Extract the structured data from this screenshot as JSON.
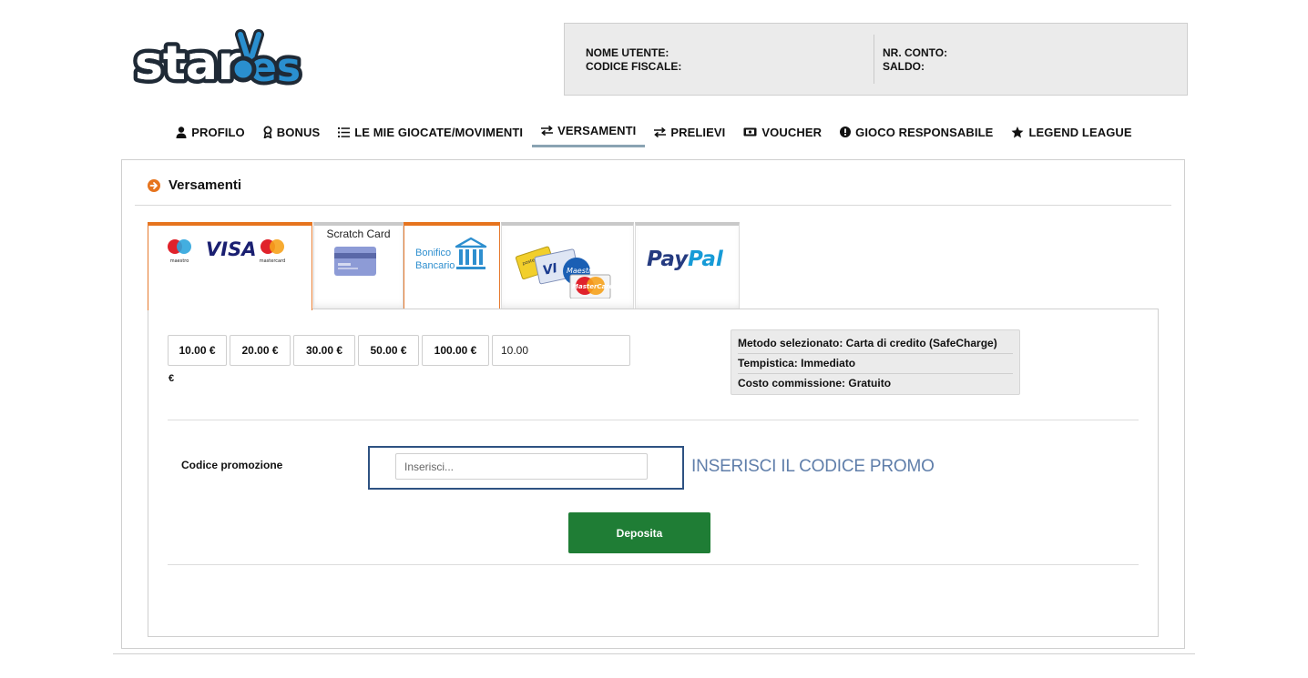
{
  "header": {
    "logo_text": "starVes",
    "account": {
      "username_label": "NOME UTENTE:",
      "fiscal_code_label": "CODICE FISCALE:",
      "account_number_label": "NR. CONTO:",
      "balance_label": "SALDO:"
    }
  },
  "nav": {
    "items": [
      {
        "label": "PROFILO",
        "icon": "user-icon"
      },
      {
        "label": "BONUS",
        "icon": "award-icon"
      },
      {
        "label": "LE MIE GIOCATE/MOVIMENTI",
        "icon": "list-icon"
      },
      {
        "label": "VERSAMENTI",
        "icon": "transfer-icon",
        "active": true
      },
      {
        "label": "PRELIEVI",
        "icon": "transfer-icon"
      },
      {
        "label": "VOUCHER",
        "icon": "ticket-icon"
      },
      {
        "label": "GIOCO RESPONSABILE",
        "icon": "info-circle-icon"
      },
      {
        "label": "LEGEND LEAGUE",
        "icon": "star-icon"
      }
    ]
  },
  "panel": {
    "title": "Versamenti",
    "tabs": [
      {
        "id": "cards",
        "logos": [
          "maestro",
          "VISA",
          "mastercard"
        ],
        "active": true
      },
      {
        "id": "scratch",
        "label": "Scratch Card"
      },
      {
        "id": "bank",
        "label_line1": "Bonifico",
        "label_line2": "Bancario"
      },
      {
        "id": "prepaid",
        "logos": [
          "VISA",
          "Maestro",
          "MasterCard"
        ]
      },
      {
        "id": "paypal",
        "logo": "PayPal"
      }
    ],
    "amounts": [
      "10.00 €",
      "20.00 €",
      "30.00 €",
      "50.00 €",
      "100.00 €"
    ],
    "amount_value": "10.00",
    "currency": "€",
    "info": {
      "method": "Metodo selezionato: Carta di credito (SafeCharge)",
      "timing": "Tempistica: Immediato",
      "fee": "Costo commissione: Gratuito"
    },
    "promo": {
      "label": "Codice promozione",
      "placeholder": "Inserisci...",
      "hint": "INSERISCI IL CODICE PROMO"
    },
    "deposit_label": "Deposita"
  },
  "colors": {
    "accent_orange": "#e6741e",
    "deposit_green": "#1f7d35",
    "promo_blue": "#2e5282",
    "nav_active": "#8aa3b3"
  }
}
